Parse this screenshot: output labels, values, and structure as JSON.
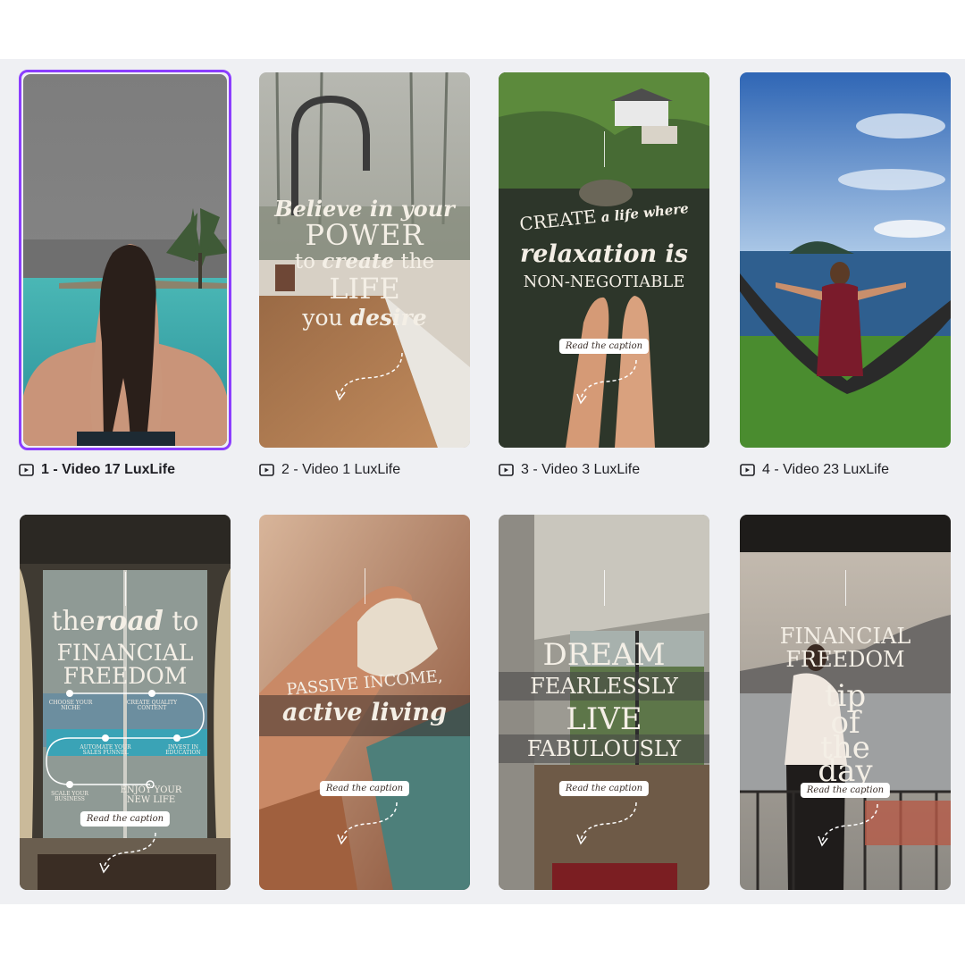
{
  "designs": [
    {
      "label": "1 - Video 17 LuxLife",
      "selected": true
    },
    {
      "label": "2 - Video 1 LuxLife",
      "selected": false,
      "overlay": {
        "line1": "Believe in your",
        "line2": "POWER",
        "line3a": "to ",
        "line3b": "create",
        "line3c": " the",
        "line4": "LIFE",
        "line5a": "you ",
        "line5b": "desire"
      }
    },
    {
      "label": "3 - Video 3 LuxLife",
      "selected": false,
      "overlay": {
        "line1a": "CREATE",
        "line1b": " a life where",
        "line2": "relaxation is",
        "line3": "NON-NEGOTIABLE",
        "pill": "Read the caption"
      }
    },
    {
      "label": "4 - Video 23 LuxLife",
      "selected": false
    },
    {
      "label": "",
      "selected": false,
      "overlay": {
        "line1a": "the",
        "line1b": "road",
        "line1c": " to",
        "line2": "FINANCIAL",
        "line3": "FREEDOM",
        "steps": [
          "CHOOSE YOUR NICHE",
          "CREATE QUALITY CONTENT",
          "AUTOMATE YOUR SALES FUNNEL",
          "INVEST IN EDUCATION",
          "SCALE YOUR BUSINESS"
        ],
        "final": "ENJOY YOUR NEW LIFE",
        "pill": "Read the caption"
      }
    },
    {
      "label": "",
      "selected": false,
      "overlay": {
        "line1": "PASSIVE INCOME,",
        "line2": "active living",
        "pill": "Read the caption"
      }
    },
    {
      "label": "",
      "selected": false,
      "overlay": {
        "line1": "DREAM",
        "line2": "FEARLESSLY",
        "line3": "LIVE",
        "line4": "FABULOUSLY",
        "pill": "Read the caption"
      }
    },
    {
      "label": "",
      "selected": false,
      "overlay": {
        "line1": "FINANCIAL",
        "line2": "FREEDOM",
        "line3": "tip",
        "line4": "of",
        "line5": "the",
        "line6": "day",
        "pill": "Read the caption"
      }
    }
  ],
  "icons": {
    "label_icon": "video-icon"
  },
  "colors": {
    "selection": "#8b3dff",
    "panel": "#eff0f3"
  }
}
